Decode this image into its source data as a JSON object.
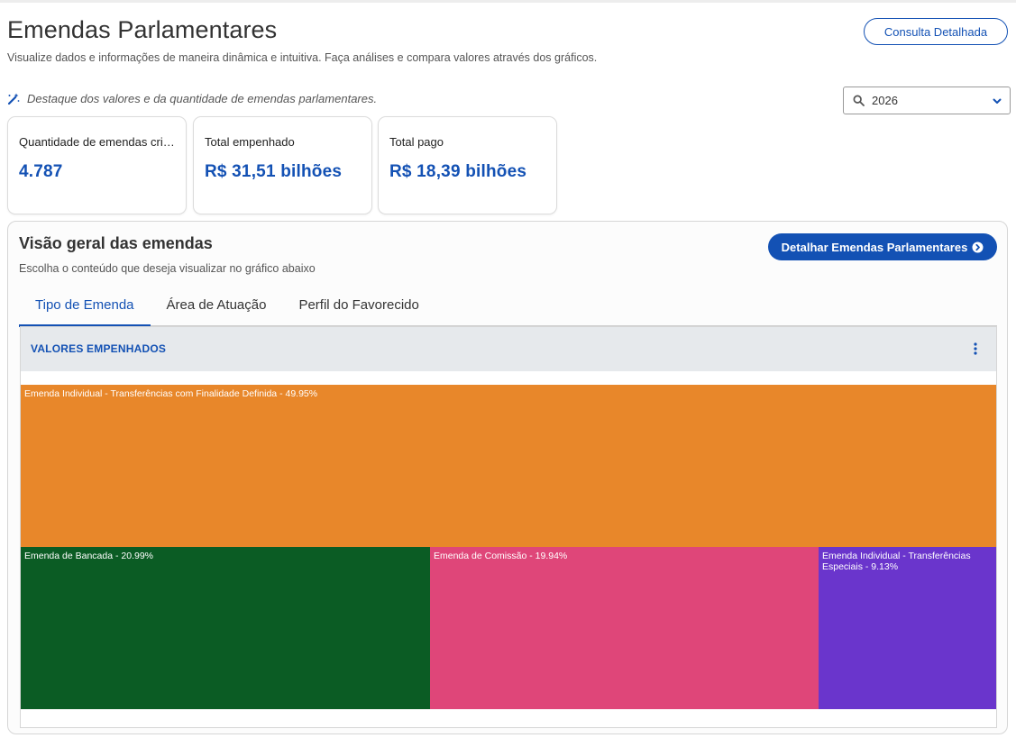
{
  "header": {
    "title": "Emendas Parlamentares",
    "subtitle": "Visualize dados e informações de maneira dinâmica e intuitiva. Faça análises e compara valores através dos gráficos.",
    "consulta_label": "Consulta Detalhada"
  },
  "highlight": {
    "text": "Destaque dos valores e da quantidade de emendas parlamentares.",
    "icon": "magic-wand-icon"
  },
  "year_select": {
    "value": "2026",
    "icon": "search-icon"
  },
  "cards": [
    {
      "label": "Quantidade de emendas criadas",
      "value": "4.787"
    },
    {
      "label": "Total empenhado",
      "value": "R$ 31,51 bilhões"
    },
    {
      "label": "Total pago",
      "value": "R$ 18,39 bilhões"
    }
  ],
  "overview": {
    "title": "Visão geral das emendas",
    "subtitle": "Escolha o conteúdo que deseja visualizar no gráfico abaixo",
    "detail_button": "Detalhar Emendas Parlamentares",
    "tabs": [
      {
        "label": "Tipo de Emenda",
        "active": true
      },
      {
        "label": "Área de Atuação",
        "active": false
      },
      {
        "label": "Perfil do Favorecido",
        "active": false
      }
    ],
    "panel_title": "VALORES EMPENHADOS"
  },
  "colors": {
    "primary": "#1351b4",
    "tile1": "#e8872a",
    "tile2": "#0b5c24",
    "tile3": "#df4679",
    "tile4": "#6a35cc"
  },
  "chart_data": {
    "type": "treemap",
    "items": [
      {
        "label": "Emenda Individual - Transferências com Finalidade Definida - 49.95%",
        "value": 49.95
      },
      {
        "label": "Emenda de Bancada - 20.99%",
        "value": 20.99
      },
      {
        "label": "Emenda de Comissão - 19.94%",
        "value": 19.94
      },
      {
        "label": "Emenda Individual - Transferências Especiais - 9.13%",
        "value": 9.13
      }
    ]
  }
}
